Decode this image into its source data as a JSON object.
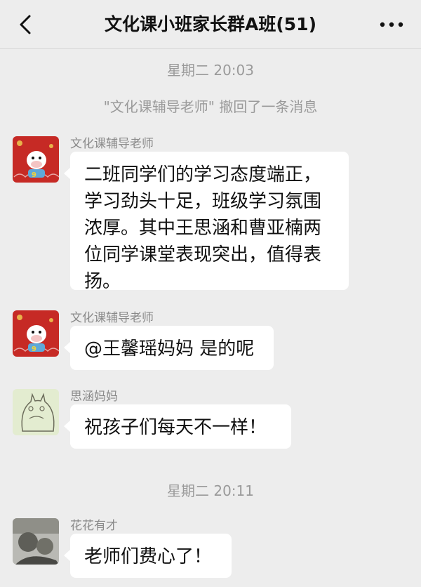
{
  "header": {
    "title": "文化课小班家长群A班(51)",
    "back_icon": "chevron-left-icon",
    "more_icon": "more-dots-icon"
  },
  "messages": {
    "timestamp1": "星期二 20:03",
    "system_recall": "\"文化课辅导老师\" 撤回了一条消息",
    "m1": {
      "sender": "文化课辅导老师",
      "text": "二班同学们的学习态度端正，学习劲头十足，班级学习氛围浓厚。其中王思涵和曹亚楠两位同学课堂表现突出，值得表扬。"
    },
    "m2": {
      "sender": "文化课辅导老师",
      "text": "@王馨瑶妈妈 是的呢"
    },
    "m3": {
      "sender": "思涵妈妈",
      "text": "祝孩子们每天不一样！"
    },
    "timestamp2": "星期二 20:11",
    "m4": {
      "sender": "花花有才",
      "text": "老师们费心了！"
    }
  },
  "colors": {
    "background": "#ededed",
    "bubble": "#ffffff",
    "meta_text": "#9a9a9a",
    "teacher_avatar_bg": "#c62a25",
    "totoro_avatar_bg": "#e3ecd0"
  }
}
